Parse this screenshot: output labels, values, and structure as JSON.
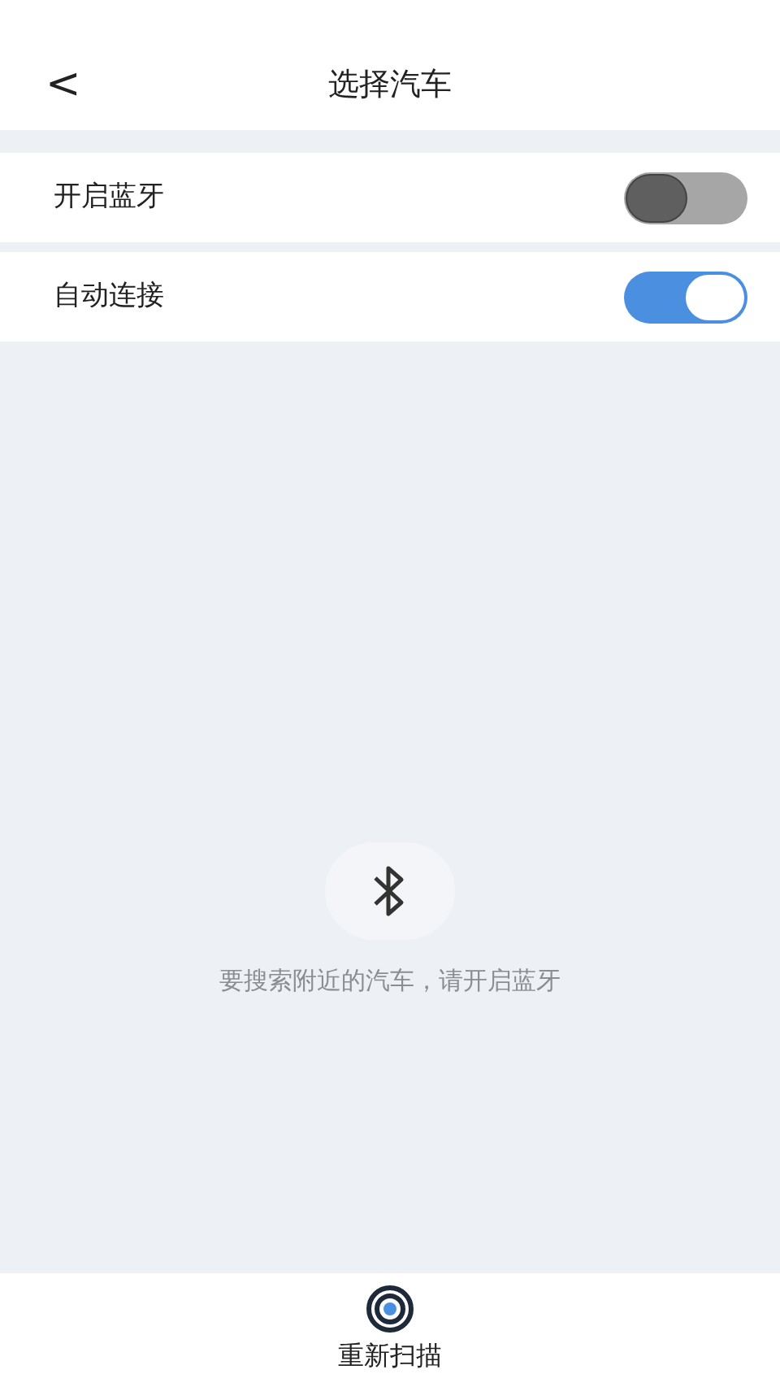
{
  "header": {
    "back": "<",
    "title": "选择汽车"
  },
  "settings": [
    {
      "label": "开启蓝牙",
      "on": false
    },
    {
      "label": "自动连接",
      "on": true
    }
  ],
  "empty_state": {
    "message": "要搜索附近的汽车，请开启蓝牙"
  },
  "bottom_bar": {
    "rescan": "重新扫描"
  }
}
